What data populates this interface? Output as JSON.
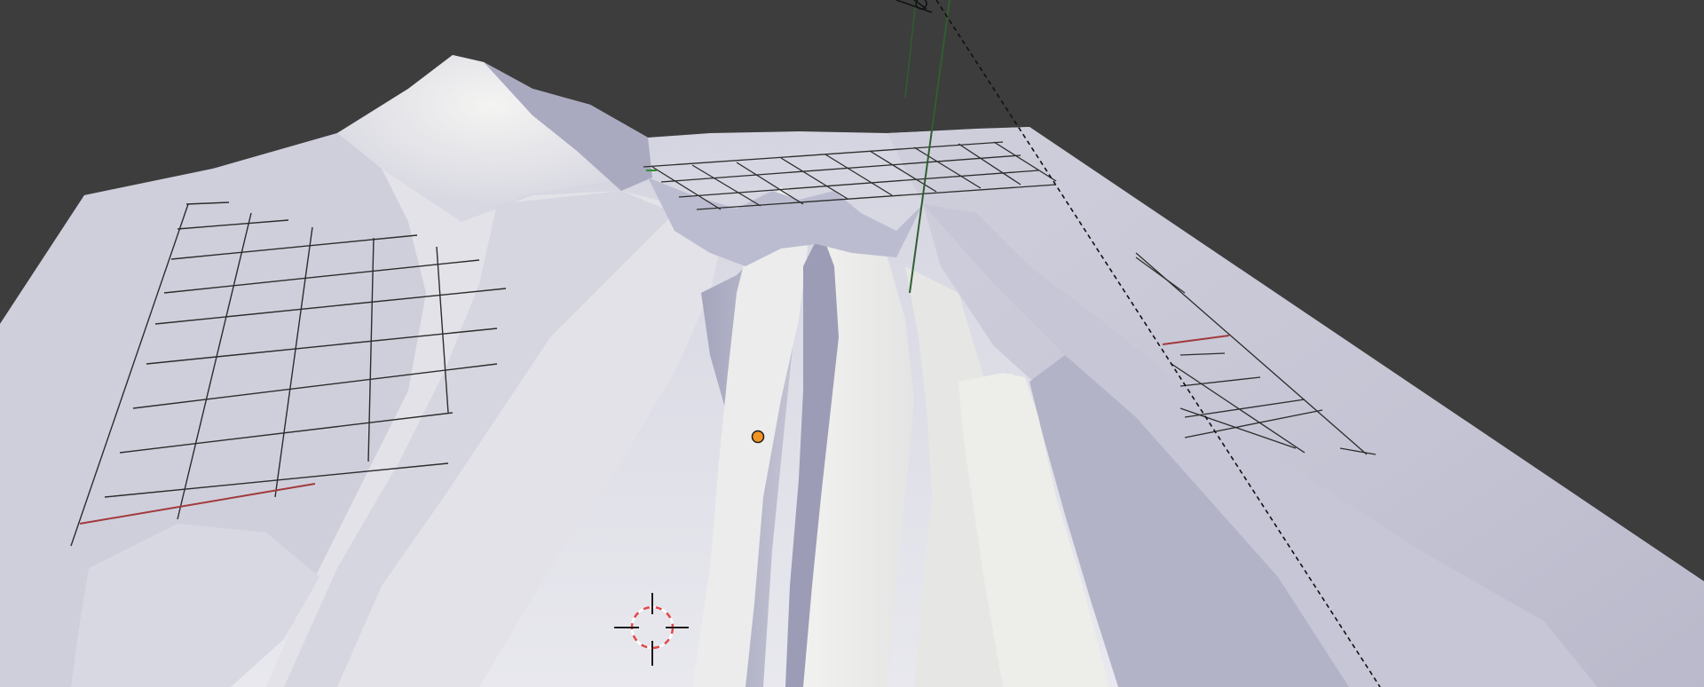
{
  "viewport": {
    "background_color": "#3d3d3d",
    "terrain_color": "#e9e9ec",
    "terrain_shadow_color": "#b6b6c8",
    "grid_line_color": "#2a2a2a",
    "x_axis_color": "#a13a3a",
    "y_axis_color": "#2f5e2f",
    "origin_color": "#f29322",
    "cursor_color": "#e04848",
    "cursor_cross_color": "#1a1a1a"
  },
  "icons": {
    "origin": "object-origin-icon",
    "cursor": "3d-cursor-icon"
  }
}
